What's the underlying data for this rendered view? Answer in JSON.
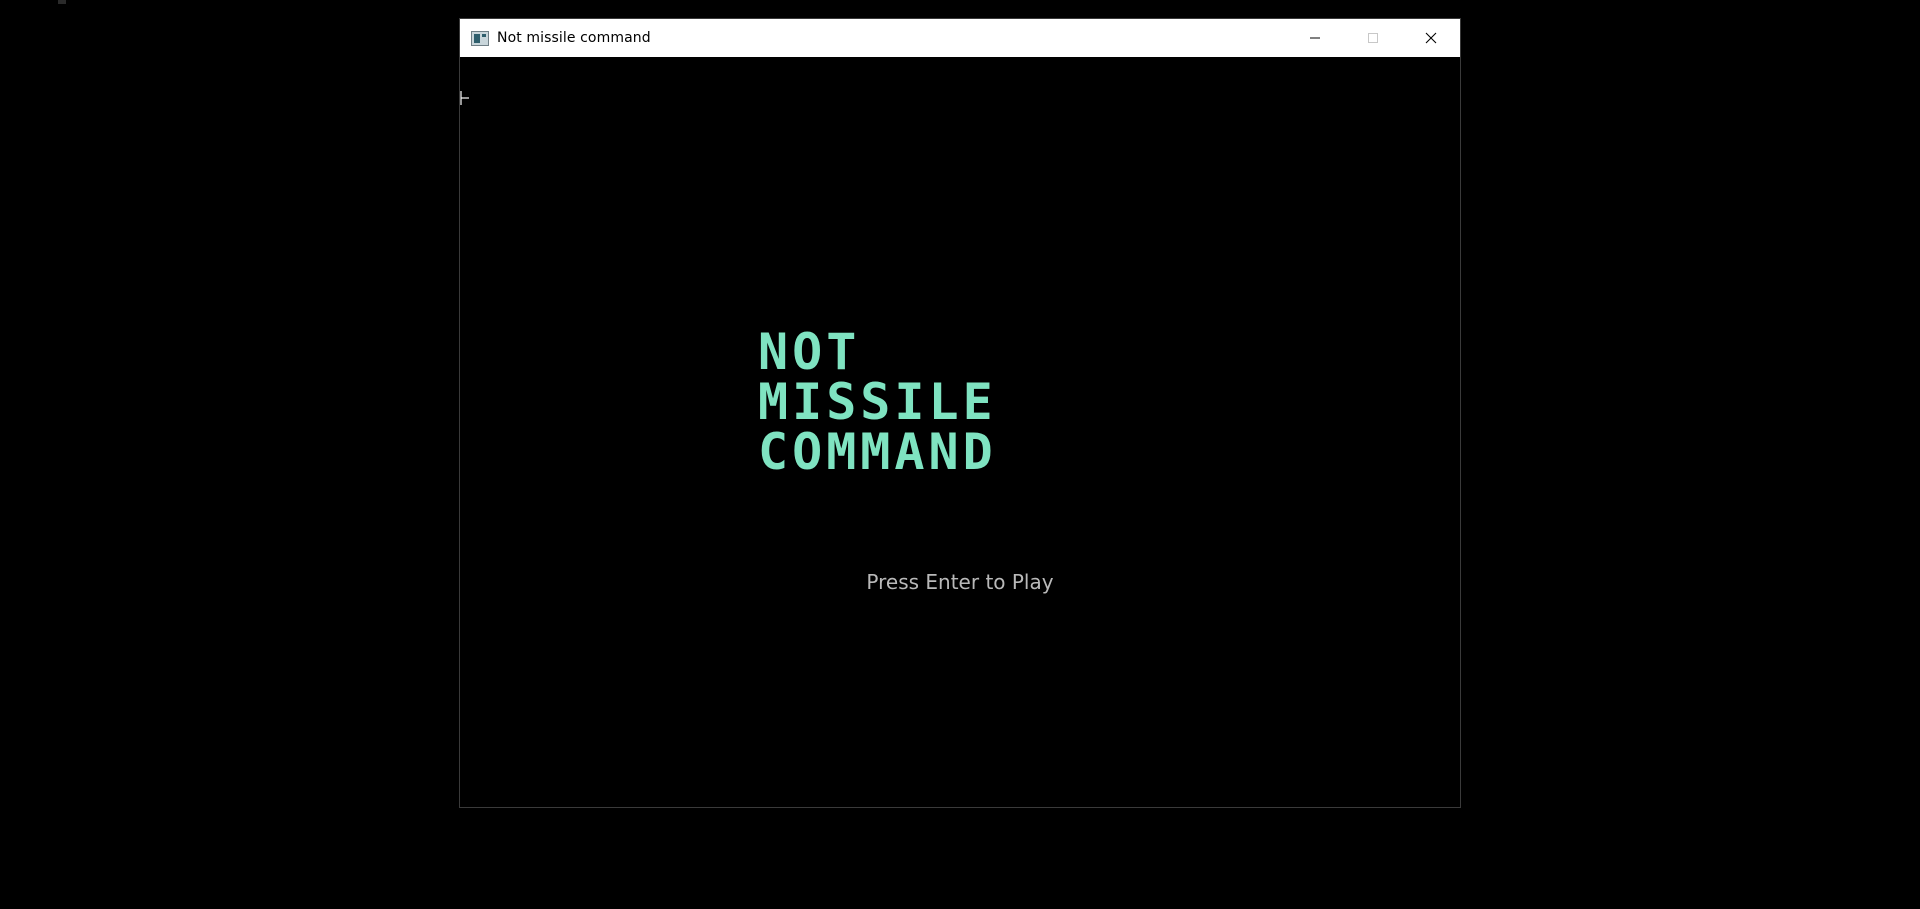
{
  "window": {
    "title": "Not missile command",
    "icon": "app-window-icon",
    "controls": {
      "minimize_icon": "minimize-icon",
      "maximize_icon": "maximize-icon",
      "close_icon": "close-icon"
    }
  },
  "game": {
    "logo_lines": [
      "NOT",
      "MISSILE",
      "COMMAND"
    ],
    "prompt": "Press Enter to Play",
    "colors": {
      "logo": "#7fe3c1",
      "prompt": "#b9b9b9",
      "background": "#000000"
    }
  }
}
